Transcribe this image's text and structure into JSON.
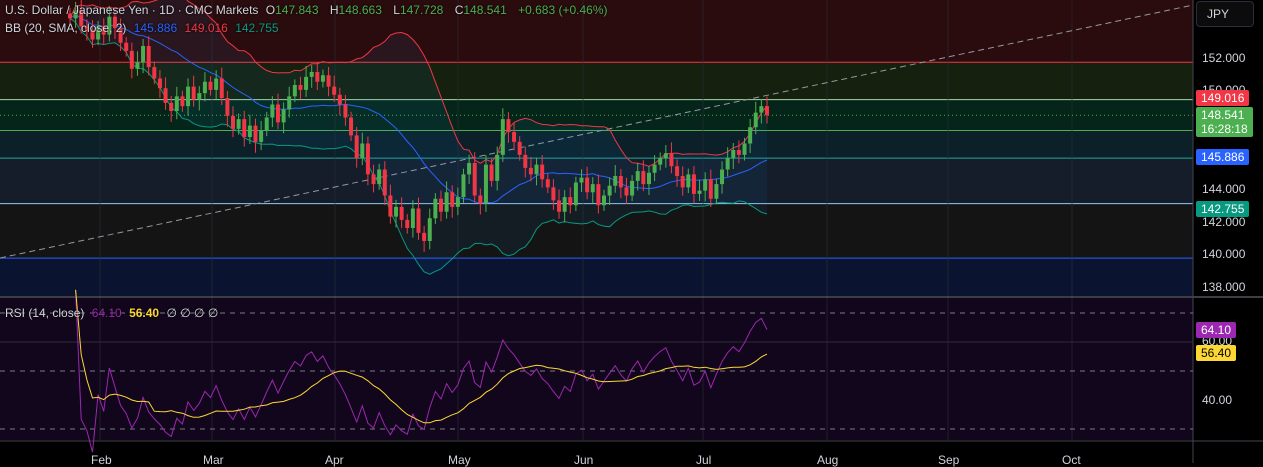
{
  "header": {
    "symbol": "U.S. Dollar / Japanese Yen · 1D · CMC Markets",
    "o_label": "O",
    "o": "147.843",
    "h_label": "H",
    "h": "148.663",
    "l_label": "L",
    "l": "147.728",
    "c_label": "C",
    "c": "148.541",
    "change": "+0.683 (+0.46%)"
  },
  "bb_legend": {
    "label": "BB (20, SMA, close, 2)",
    "basis": "145.886",
    "upper": "149.016",
    "lower": "142.755"
  },
  "rsi_legend": {
    "label": "RSI (14, close)",
    "rsi": "64.10",
    "ma": "56.40",
    "extra": "∅ ∅ ∅ ∅"
  },
  "currency_button": "JPY",
  "price_axis": {
    "ticks": [
      "152.000",
      "150.000",
      "144.000",
      "142.000",
      "140.000",
      "138.000"
    ]
  },
  "badges": {
    "upper": "149.016",
    "last": "148.541",
    "countdown": "16:28:18",
    "basis": "145.886",
    "lower": "142.755",
    "rsi": "64.10",
    "rsi_ma": "56.40"
  },
  "rsi_axis": {
    "ticks": [
      "60.00",
      "40.00"
    ]
  },
  "time_axis": {
    "ticks": [
      "Feb",
      "Mar",
      "Apr",
      "May",
      "Jun",
      "Jul",
      "Aug",
      "Sep",
      "Oct"
    ]
  },
  "colors": {
    "up": "#4caf50",
    "down": "#f23645",
    "basis": "#2962ff",
    "upper": "#f23645",
    "lower": "#089981",
    "rsi": "#9c27b0",
    "rsi_ma": "#fdd835"
  },
  "chart_data": {
    "type": "candlestick",
    "title": "U.S. Dollar / Japanese Yen · 1D · CMC Markets",
    "ylim": [
      137,
      156
    ],
    "rsi_ylim": [
      20,
      80
    ],
    "levels": [
      151.8,
      149.5,
      147.6,
      145.9,
      143.1,
      139.75
    ],
    "closes": [
      154.5,
      155,
      154,
      153.8,
      153.2,
      154,
      153.5,
      154.6,
      153.9,
      153,
      152.5,
      151.4,
      151.8,
      152.8,
      151.5,
      150.8,
      150.2,
      149.3,
      148.8,
      149.7,
      149.1,
      150.3,
      149.5,
      149.9,
      150.6,
      150.1,
      150.8,
      149.6,
      148.5,
      147.7,
      148.3,
      147.2,
      147.9,
      146.9,
      147.6,
      148.4,
      149.2,
      148.1,
      148.9,
      149.7,
      150.4,
      150.1,
      150.9,
      151.2,
      150.6,
      151.0,
      150.3,
      149.8,
      149.2,
      148.4,
      147.3,
      145.9,
      146.8,
      144.9,
      144.3,
      145.2,
      143.6,
      142.3,
      142.9,
      142.1,
      141.6,
      142.8,
      141.3,
      140.8,
      142.2,
      143.4,
      142.6,
      143.8,
      142.9,
      143.5,
      144.9,
      145.6,
      143.6,
      143.1,
      145.5,
      144.5,
      146.1,
      148.3,
      147.5,
      146.9,
      146.1,
      145.3,
      144.9,
      145.5,
      144.6,
      144.1,
      143.3,
      142.6,
      143.5,
      143.0,
      144.4,
      144.7,
      143.8,
      144.3,
      143.0,
      143.6,
      144.2,
      144.8,
      144.1,
      143.6,
      144.5,
      145.1,
      144.3,
      145.0,
      145.5,
      145.9,
      146.2,
      145.4,
      144.8,
      144.1,
      144.9,
      143.7,
      143.9,
      144.6,
      143.4,
      144.3,
      145.2,
      145.9,
      146.4,
      146.1,
      146.8,
      147.8,
      148.7,
      149.1,
      148.541
    ]
  }
}
